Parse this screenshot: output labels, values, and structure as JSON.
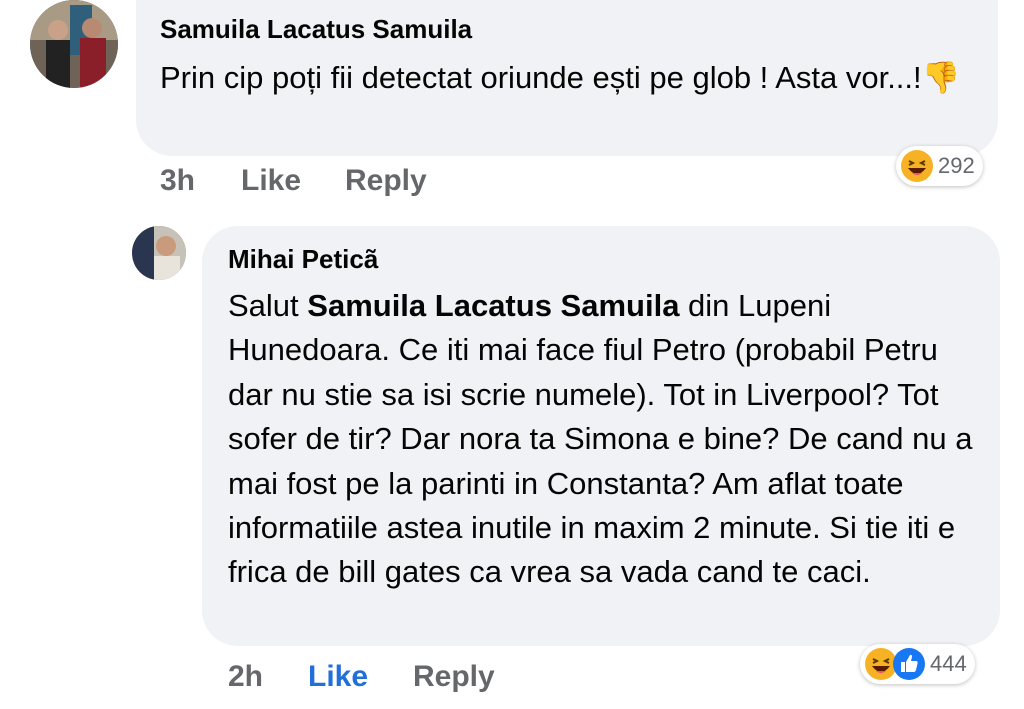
{
  "comments": [
    {
      "author": "Samuila Lacatus Samuila",
      "text": "Prin cip poți fii detectat oriunde ești pe glob ! Asta vor...!",
      "emoji_inline": "👎",
      "time": "3h",
      "like_label": "Like",
      "reply_label": "Reply",
      "reaction_count": "292",
      "reaction_icons": [
        "haha-icon"
      ]
    },
    {
      "author": "Mihai Peticã",
      "text_prefix": "Salut ",
      "mention": "Samuila Lacatus Samuila",
      "text_suffix": "  din Lupeni Hunedoara. Ce iti mai face fiul Petro (probabil Petru dar nu stie sa isi scrie numele). Tot in Liverpool? Tot sofer de tir? Dar nora ta Simona e bine? De cand nu a mai fost pe la parinti in Constanta? Am aflat toate informatiile astea inutile in maxim 2 minute. Si tie iti e frica de bill gates ca vrea sa vada cand te caci.",
      "time": "2h",
      "like_label": "Like",
      "reply_label": "Reply",
      "reaction_count": "444",
      "reaction_icons": [
        "haha-icon",
        "like-icon"
      ]
    }
  ],
  "colors": {
    "bubble": "#f0f2f5",
    "meta": "#65676b",
    "like_active": "#216fdb"
  }
}
